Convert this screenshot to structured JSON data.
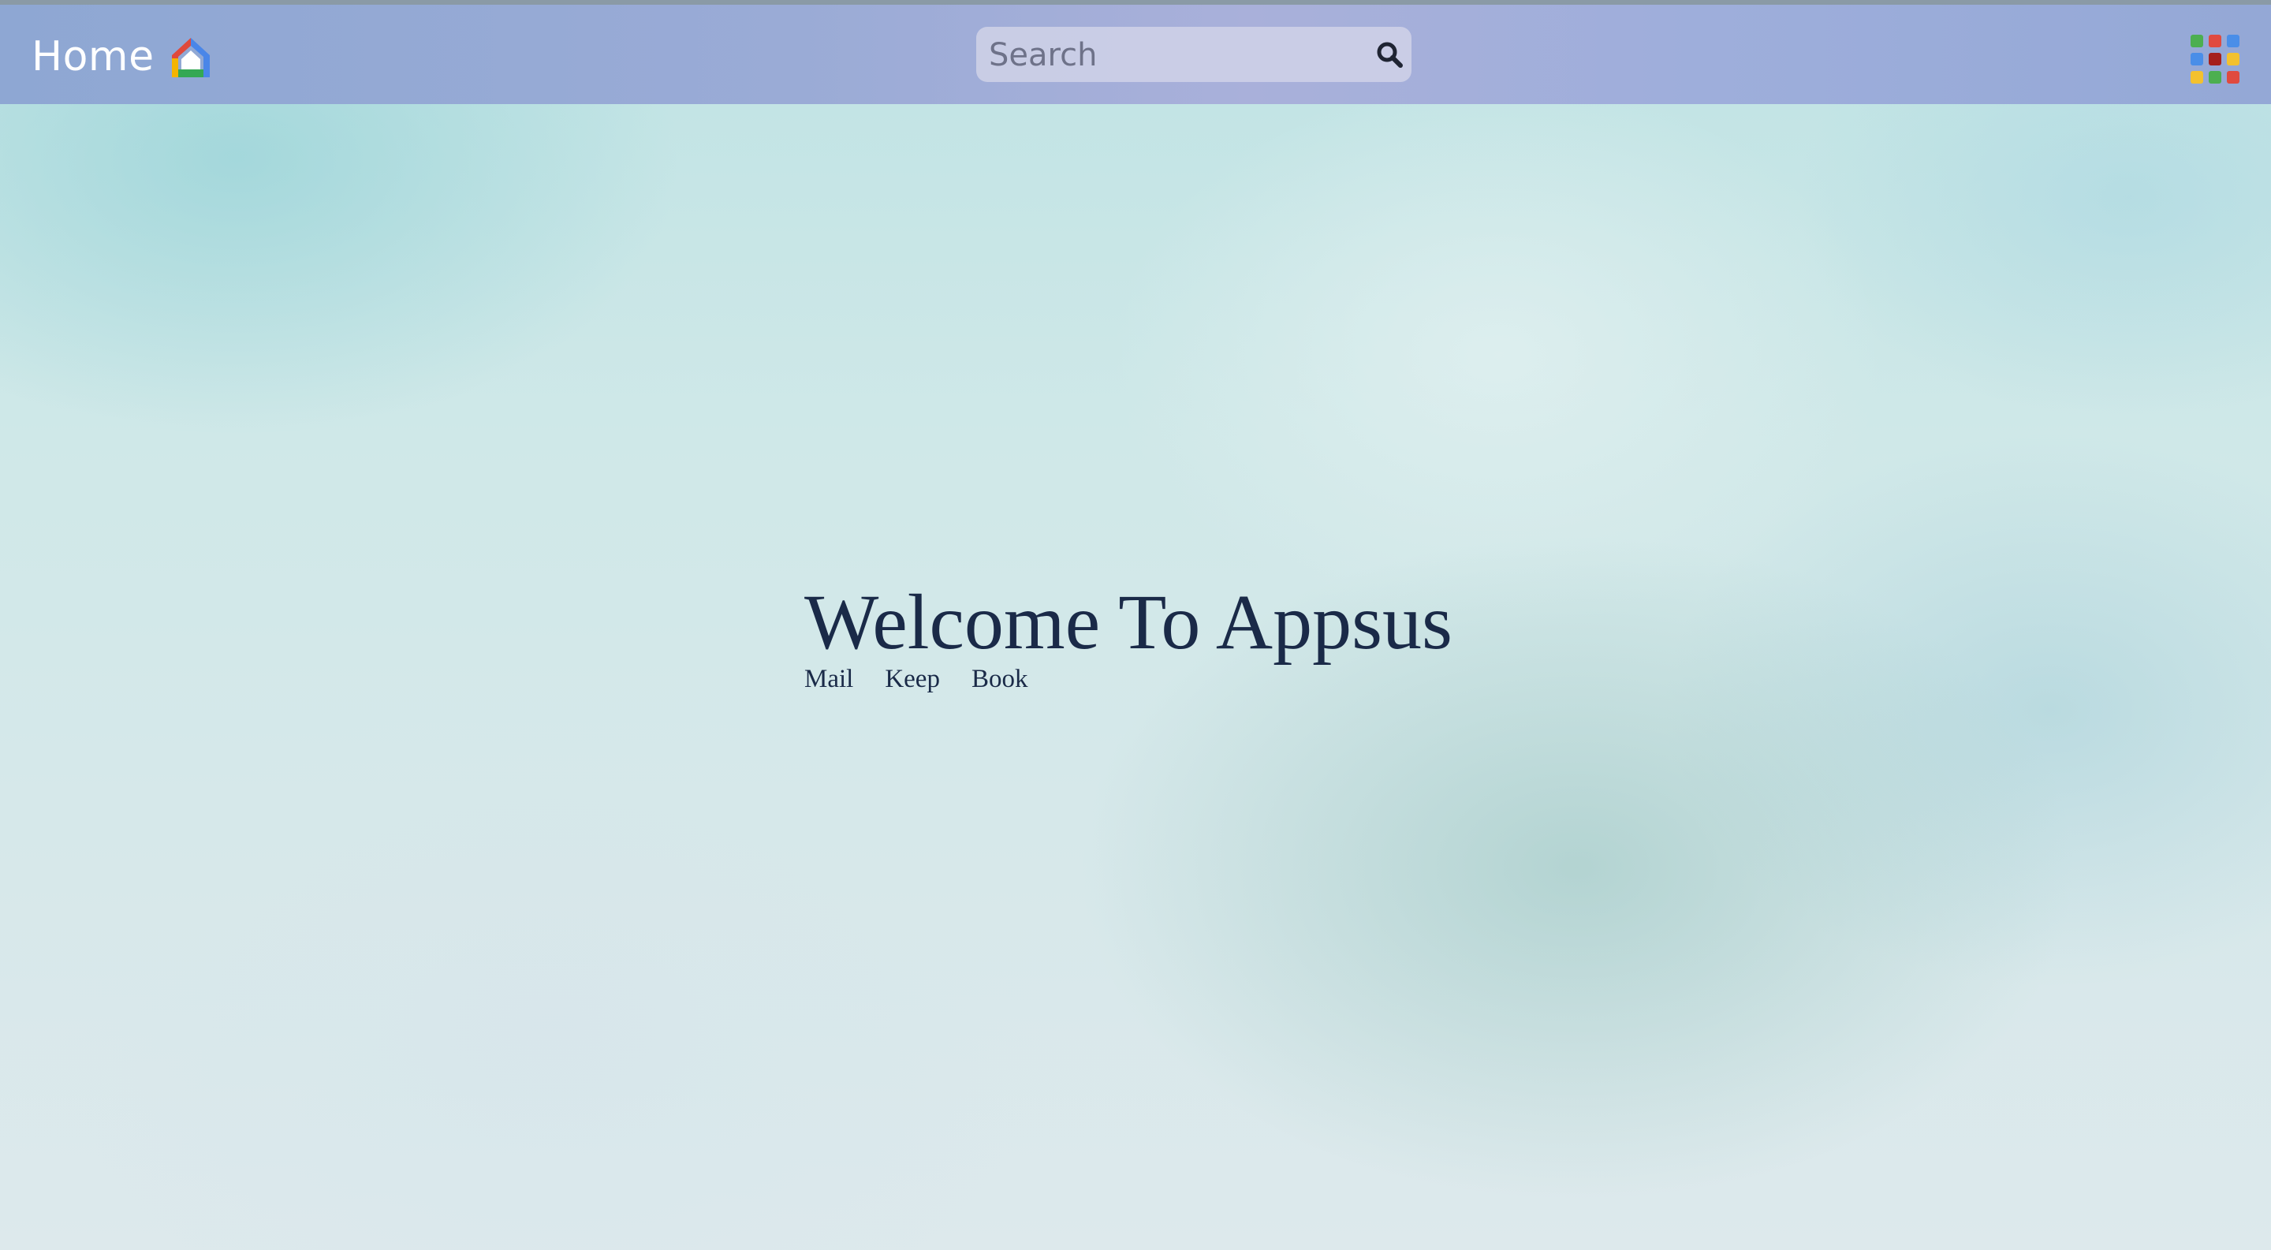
{
  "header": {
    "title": "Home",
    "home_icon": "home-icon",
    "search": {
      "placeholder": "Search",
      "value": "",
      "icon": "search-icon"
    },
    "apps_icon": "apps-grid-icon",
    "apps_grid_colors": [
      "#4caf50",
      "#e04a3f",
      "#4a8ee8",
      "#4a8ee8",
      "#a5201c",
      "#f3c12f",
      "#f3c12f",
      "#4caf50",
      "#e04a3f"
    ]
  },
  "main": {
    "title": "Welcome To Appsus",
    "links": [
      {
        "label": "Mail"
      },
      {
        "label": "Keep"
      },
      {
        "label": "Book"
      }
    ]
  },
  "colors": {
    "header_bg": "#9aabd6",
    "title_text": "#1a2a48"
  }
}
